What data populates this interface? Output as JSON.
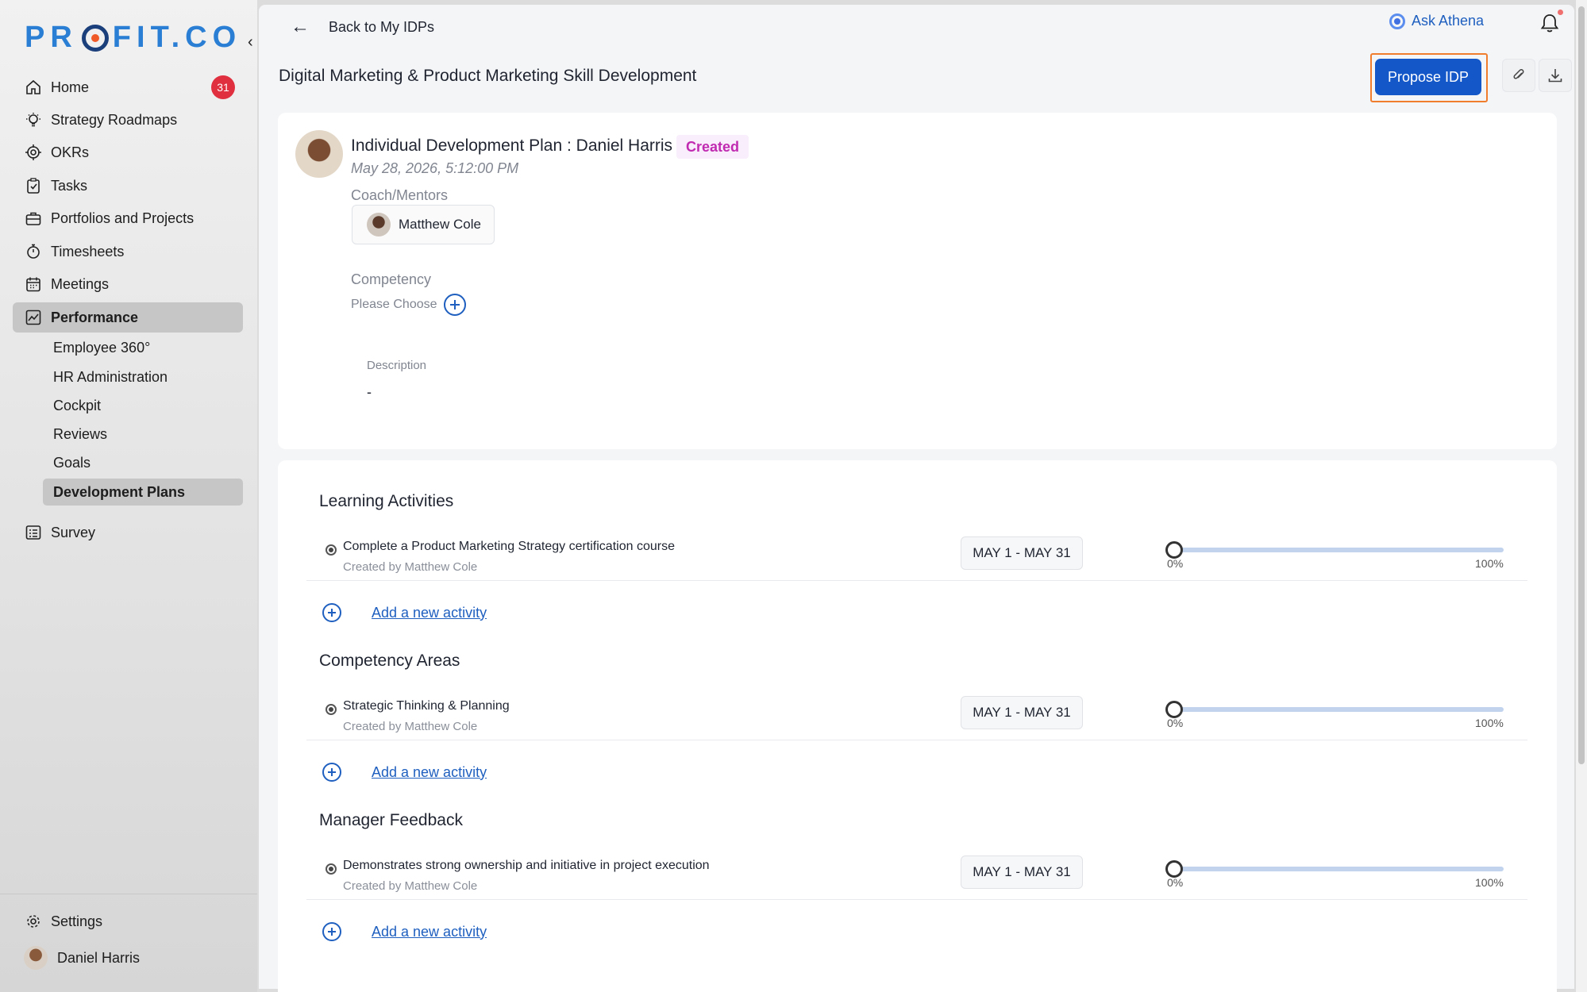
{
  "brand": {
    "logo_text_a": "PR",
    "logo_text_b": "FIT.CO",
    "accent": "#2a7fd4",
    "logo_ring": "#1b3f7a",
    "logo_dot": "#f05a28"
  },
  "sidebar": {
    "items": [
      {
        "label": "Home",
        "icon": "home-icon",
        "badge": "31"
      },
      {
        "label": "Strategy Roadmaps",
        "icon": "lightbulb-icon"
      },
      {
        "label": "OKRs",
        "icon": "target-icon"
      },
      {
        "label": "Tasks",
        "icon": "clipboard-check-icon"
      },
      {
        "label": "Portfolios and Projects",
        "icon": "briefcase-icon"
      },
      {
        "label": "Timesheets",
        "icon": "stopwatch-icon"
      },
      {
        "label": "Meetings",
        "icon": "calendar-icon"
      },
      {
        "label": "Performance",
        "icon": "chart-line-icon",
        "active": true
      }
    ],
    "sub_items": [
      {
        "label": "Employee 360°"
      },
      {
        "label": "HR Administration"
      },
      {
        "label": "Cockpit"
      },
      {
        "label": "Reviews"
      },
      {
        "label": "Goals"
      },
      {
        "label": "Development Plans",
        "active": true
      }
    ],
    "survey": {
      "label": "Survey",
      "icon": "survey-icon"
    },
    "settings": {
      "label": "Settings",
      "icon": "gear-icon"
    },
    "user": {
      "name": "Daniel Harris"
    }
  },
  "topbar": {
    "back_label": "Back to My IDPs",
    "athena_label": "Ask Athena"
  },
  "header": {
    "title": "Digital Marketing & Product Marketing Skill Development",
    "propose_label": "Propose IDP",
    "primary_color": "#1357c9"
  },
  "idp": {
    "title": "Individual Development Plan : Daniel Harris",
    "status": "Created",
    "status_color": "#c02bb1",
    "date": "May 28, 2026, 5:12:00 PM",
    "coach_label": "Coach/Mentors",
    "coach_name": "Matthew Cole",
    "competency_label": "Competency",
    "competency_placeholder": "Please Choose",
    "description_label": "Description",
    "description_value": "-"
  },
  "sections": [
    {
      "title": "Learning Activities",
      "activities": [
        {
          "name": "Complete a Product Marketing Strategy certification course",
          "created_by": "Created by Matthew Cole",
          "dates": "MAY 1 - MAY 31",
          "progress": 0,
          "min_label": "0%",
          "max_label": "100%"
        }
      ],
      "add_label": "Add a new activity"
    },
    {
      "title": "Competency Areas",
      "activities": [
        {
          "name": "Strategic Thinking & Planning",
          "created_by": "Created by Matthew Cole",
          "dates": "MAY 1 - MAY 31",
          "progress": 0,
          "min_label": "0%",
          "max_label": "100%"
        }
      ],
      "add_label": "Add a new activity"
    },
    {
      "title": "Manager Feedback",
      "activities": [
        {
          "name": "Demonstrates strong ownership and initiative in project execution",
          "created_by": "Created by Matthew Cole",
          "dates": "MAY 1 - MAY 31",
          "progress": 0,
          "min_label": "0%",
          "max_label": "100%"
        }
      ],
      "add_label": "Add a new activity"
    }
  ]
}
